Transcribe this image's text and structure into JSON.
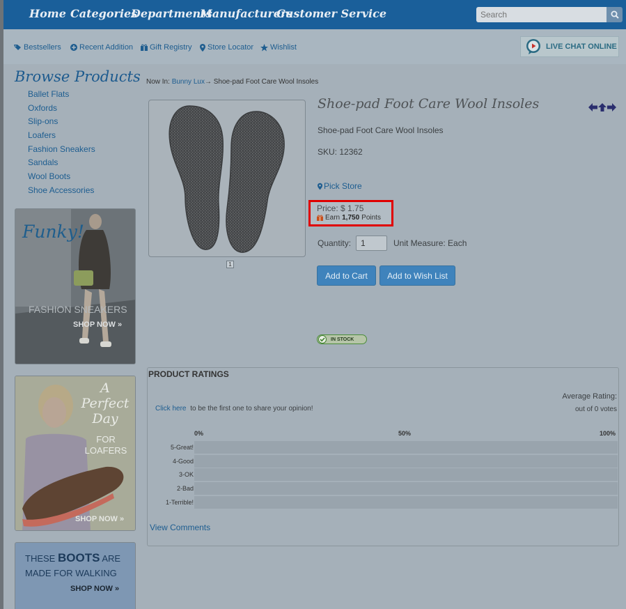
{
  "nav": {
    "items": [
      "Home",
      "Categories",
      "Departments",
      "Manufacturers",
      "Customer Service"
    ],
    "search_placeholder": "Search"
  },
  "subnav": {
    "links": [
      "Bestsellers",
      "Recent Addition",
      "Gift Registry",
      "Store Locator",
      "Wishlist"
    ],
    "live_chat": "LIVE CHAT ONLINE"
  },
  "sidebar": {
    "title": "Browse Products",
    "categories": [
      "Ballet Flats",
      "Oxfords",
      "Slip-ons",
      "Loafers",
      "Fashion Sneakers",
      "Sandals",
      "Wool Boots",
      "Shoe Accessories"
    ],
    "banners": [
      {
        "headline": "Funky!",
        "subtitle": "FASHION SNEAKERS",
        "cta": "SHOP NOW »"
      },
      {
        "headline": "A Perfect Day",
        "subtitle": "FOR LOAFERS",
        "cta": "SHOP NOW »"
      },
      {
        "headline_prefix": "THESE",
        "headline_bold": "BOOTS",
        "headline_suffix": "ARE",
        "line2": "MADE FOR WALKING",
        "cta": "SHOP NOW »"
      }
    ]
  },
  "breadcrumb": {
    "prefix": "Now In:",
    "parent": "Bunny Lux",
    "separator": "→",
    "current": "Shoe-pad Foot Care Wool Insoles"
  },
  "product": {
    "title": "Shoe-pad Foot Care Wool Insoles",
    "subtitle": "Shoe-pad Foot Care Wool Insoles",
    "sku": "SKU: 12362",
    "pick_store": "Pick Store",
    "price": "Price: $ 1.75",
    "earn_prefix": "Earn",
    "earn_points": "1,750",
    "earn_suffix": "Points",
    "quantity_label": "Quantity:",
    "quantity_value": "1",
    "unit_measure": "Unit Measure:  Each",
    "add_to_cart": "Add to Cart",
    "add_to_wishlist": "Add to Wish List",
    "stock_status": "IN STOCK",
    "image_index": "1"
  },
  "ratings": {
    "title": "PRODUCT RATINGS",
    "average_label": "Average Rating:",
    "votes": "out of 0 votes",
    "click_here": "Click here",
    "first_opinion": "to be the first one to share your opinion!",
    "scale": [
      "0%",
      "50%",
      "100%"
    ],
    "rows": [
      {
        "label": "5-Great!",
        "value": 0
      },
      {
        "label": "4-Good",
        "value": 0
      },
      {
        "label": "3-OK",
        "value": 0
      },
      {
        "label": "2-Bad",
        "value": 0
      },
      {
        "label": "1-Terrible!",
        "value": 0
      }
    ],
    "view_comments": "View Comments"
  },
  "colors": {
    "nav_bg": "#1a5f9a",
    "link": "#1d5d90",
    "highlight": "#e00000",
    "button": "#3f83bc"
  }
}
